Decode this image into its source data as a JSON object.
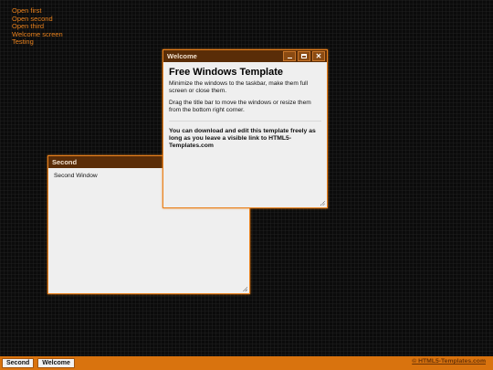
{
  "menu": {
    "items": [
      "Open first",
      "Open second",
      "Open third",
      "Welcome screen",
      "Testing"
    ]
  },
  "windows": {
    "second": {
      "title": "Second",
      "body": "Second Window"
    },
    "welcome": {
      "title": "Welcome",
      "heading": "Free Windows Template",
      "p1": "Minimize the windows to the taskbar, make them full screen or close them.",
      "p2": "Drag the title bar to move the windows or resize them from the bottom right corner.",
      "note": "You can download and edit this template freely as long as you leave a visible link to HTML5-Templates.com",
      "controls": {
        "minimize": "minimize-icon",
        "maximize": "maximize-icon",
        "close": "✕"
      }
    }
  },
  "taskbar": {
    "buttons": [
      "Second",
      "Welcome"
    ],
    "credit": "© HTML5-Templates.com"
  },
  "colors": {
    "accent": "#e9811c",
    "titlebar": "#5a2d08",
    "taskbar": "#d9730e",
    "background": "#0b0b0b"
  }
}
